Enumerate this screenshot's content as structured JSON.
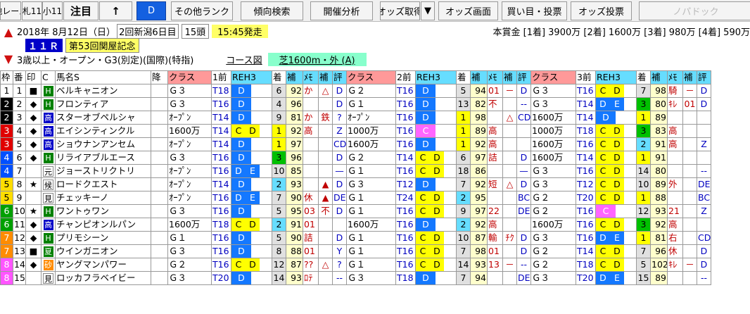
{
  "toolbar": {
    "buttons": [
      "他レース",
      "札11",
      "小11",
      "注目",
      "↑",
      "D",
      "その他ランク",
      "傾向検索",
      "開催分析",
      "オッズ取得",
      "▼",
      "オッズ画面",
      "買い目・投票",
      "オッズ投票",
      "ノパドック"
    ]
  },
  "race": {
    "date": "2018年",
    "date2": "8月12日（日）",
    "meeting": "2回新潟6日目",
    "runners": "15頭",
    "post_time": "15:45発走",
    "prize": "本賞金 [1着] 3900万 [2着] 1600万 [3着] 980万 [4着] 590万",
    "race_no": "１１Ｒ",
    "race_name": "第53回関屋記念",
    "conditions": "3歳以上・オープン・G3(別定)(国際)(特指)",
    "course_label": "コース図",
    "course": "芝1600m・外 (A)"
  },
  "columns": [
    "枠",
    "番",
    "印",
    "C",
    "馬名S",
    "降",
    "クラス",
    "1前",
    "REH3",
    "着",
    "補",
    "ﾒﾓ",
    "補",
    "評",
    "クラス",
    "2前",
    "REH3",
    "着",
    "補",
    "ﾒﾓ",
    "補",
    "評",
    "クラス",
    "3前",
    "REH3",
    "着",
    "補",
    "ﾒﾓ",
    "補",
    "評"
  ],
  "colors": {
    "accent": "#1460e0",
    "class_header": "#ff9999",
    "rating_header": "#66ddff",
    "race_mark_1": "#ffff00",
    "race_mark_2": "#66ddff"
  },
  "rows": [
    {
      "waku": "1",
      "wc": "#ffffff",
      "wt": "#000",
      "ban": "1",
      "mark": "■",
      "cbg": "#008000",
      "c": "H",
      "name": "ベルキャニオン",
      "r": [
        {
          "cls": "Ｇ３",
          "t": "T18",
          "rc": [
            "D"
          ],
          "rcb": [
            "#1478ff"
          ],
          "pos": "6",
          "h": "92",
          "memo": "か",
          "m2": "△",
          "ev": "D"
        },
        {
          "cls": "Ｇ２",
          "t": "T16",
          "rc": [
            "D"
          ],
          "rcb": [
            "#1478ff"
          ],
          "pos": "5",
          "h": "94",
          "memo": "01",
          "m2": "－",
          "ev": "D"
        },
        {
          "cls": "Ｇ３",
          "t": "T16",
          "rc": [
            "C",
            "D"
          ],
          "rcb": [
            "#ffff00",
            "#ffff00"
          ],
          "pos": "7",
          "h": "98",
          "memo": "騎",
          "m2": "－",
          "ev": "D"
        }
      ]
    },
    {
      "waku": "2",
      "wc": "#000000",
      "wt": "#fff",
      "ban": "2",
      "mark": "◆",
      "cbg": "#008000",
      "c": "H",
      "name": "フロンティア",
      "r": [
        {
          "cls": "Ｇ３",
          "t": "T16",
          "rc": [
            "D"
          ],
          "rcb": [
            "#1478ff"
          ],
          "pos": "4",
          "h": "96",
          "memo": "",
          "m2": "",
          "ev": "D"
        },
        {
          "cls": "Ｇ１",
          "t": "T16",
          "rc": [
            "D"
          ],
          "rcb": [
            "#1478ff"
          ],
          "pos": "13",
          "h": "82",
          "memo": "不",
          "m2": "",
          "ev": "--"
        },
        {
          "cls": "Ｇ３",
          "t": "T14",
          "rc": [
            "D",
            "E"
          ],
          "rcb": [
            "#1478ff",
            "#1478ff"
          ],
          "pos": "3",
          "h": "80",
          "memo": "ｷﾚ",
          "m2": "01",
          "ev": "D"
        }
      ]
    },
    {
      "waku": "2",
      "wc": "#000000",
      "wt": "#fff",
      "ban": "3",
      "mark": "◆",
      "cbg": "#0000c8",
      "c": "高",
      "name": "スターオブペルシャ",
      "r": [
        {
          "cls": "ｵｰﾌﾟﾝ",
          "t": "T14",
          "rc": [
            "D"
          ],
          "rcb": [
            "#1478ff"
          ],
          "pos": "9",
          "h": "81",
          "memo": "か",
          "m2": "鉄",
          "ev": "?"
        },
        {
          "cls": "ｵｰﾌﾟﾝ",
          "t": "T16",
          "rc": [
            "D"
          ],
          "rcb": [
            "#1478ff"
          ],
          "pos": "1",
          "h": "98",
          "memo": "",
          "m2": "△",
          "ev": "CD"
        },
        {
          "cls": "1600万",
          "t": "T14",
          "rc": [
            "D"
          ],
          "rcb": [
            "#1478ff"
          ],
          "pos": "1",
          "h": "89",
          "memo": "",
          "m2": "",
          "ev": ""
        }
      ]
    },
    {
      "waku": "3",
      "wc": "#e00000",
      "wt": "#fff",
      "ban": "4",
      "mark": "◆",
      "cbg": "#0000c8",
      "c": "高",
      "name": "エイシンティンクル",
      "r": [
        {
          "cls": "1600万",
          "t": "T14",
          "rc": [
            "C",
            "D"
          ],
          "rcb": [
            "#ffff00",
            "#ffff00"
          ],
          "pos": "1",
          "h": "92",
          "memo": "高",
          "m2": "",
          "ev": "Z"
        },
        {
          "cls": "1000万",
          "t": "T16",
          "rc": [
            "C"
          ],
          "rcb": [
            "#ff66ff"
          ],
          "pos": "1",
          "h": "89",
          "memo": "高",
          "m2": "",
          "ev": ""
        },
        {
          "cls": "1000万",
          "t": "T18",
          "rc": [
            "C",
            "D"
          ],
          "rcb": [
            "#ffff00",
            "#ffff00"
          ],
          "pos": "3",
          "h": "83",
          "memo": "高",
          "m2": "",
          "ev": ""
        }
      ]
    },
    {
      "waku": "3",
      "wc": "#e00000",
      "wt": "#fff",
      "ban": "5",
      "mark": "◆",
      "cbg": "#0000c8",
      "c": "高",
      "name": "ショウナンアンセム",
      "r": [
        {
          "cls": "ｵｰﾌﾟﾝ",
          "t": "T14",
          "rc": [
            "D"
          ],
          "rcb": [
            "#1478ff"
          ],
          "pos": "1",
          "h": "97",
          "memo": "",
          "m2": "",
          "ev": "CD"
        },
        {
          "cls": "1600万",
          "t": "T16",
          "rc": [
            "D"
          ],
          "rcb": [
            "#1478ff"
          ],
          "pos": "1",
          "h": "92",
          "memo": "高",
          "m2": "",
          "ev": ""
        },
        {
          "cls": "1600万",
          "t": "T16",
          "rc": [
            "C",
            "D"
          ],
          "rcb": [
            "#ffff00",
            "#ffff00"
          ],
          "pos": "2",
          "h": "91",
          "memo": "高",
          "m2": "",
          "ev": "Z"
        }
      ]
    },
    {
      "waku": "4",
      "wc": "#0050ff",
      "wt": "#fff",
      "ban": "6",
      "mark": "◆",
      "cbg": "#008000",
      "c": "H",
      "name": "リライアブルエース",
      "r": [
        {
          "cls": "Ｇ３",
          "t": "T16",
          "rc": [
            "D"
          ],
          "rcb": [
            "#1478ff"
          ],
          "pos": "3",
          "h": "96",
          "memo": "",
          "m2": "",
          "ev": "D"
        },
        {
          "cls": "Ｇ２",
          "t": "T14",
          "rc": [
            "C",
            "D"
          ],
          "rcb": [
            "#ffff00",
            "#ffff00"
          ],
          "pos": "6",
          "h": "97",
          "memo": "詰",
          "m2": "",
          "ev": "D"
        },
        {
          "cls": "1600万",
          "t": "T14",
          "rc": [
            "C",
            "D"
          ],
          "rcb": [
            "#ffff00",
            "#ffff00"
          ],
          "pos": "1",
          "h": "91",
          "memo": "",
          "m2": "",
          "ev": ""
        }
      ]
    },
    {
      "waku": "4",
      "wc": "#0050ff",
      "wt": "#fff",
      "ban": "7",
      "mark": "",
      "cbg": "#ffffff",
      "c": "元",
      "name": "ジョーストリクトリ",
      "r": [
        {
          "cls": "ｵｰﾌﾟﾝ",
          "t": "T16",
          "rc": [
            "D",
            "E"
          ],
          "rcb": [
            "#1478ff",
            "#1478ff"
          ],
          "pos": "10",
          "h": "85",
          "memo": "",
          "m2": "",
          "ev": "—"
        },
        {
          "cls": "Ｇ１",
          "t": "T16",
          "rc": [
            "C",
            "D"
          ],
          "rcb": [
            "#ffff00",
            "#ffff00"
          ],
          "pos": "18",
          "h": "86",
          "memo": "",
          "m2": "",
          "ev": "—"
        },
        {
          "cls": "Ｇ３",
          "t": "T16",
          "rc": [
            "C",
            "D"
          ],
          "rcb": [
            "#ffff00",
            "#ffff00"
          ],
          "pos": "14",
          "h": "80",
          "memo": "",
          "m2": "",
          "ev": "--"
        }
      ]
    },
    {
      "waku": "5",
      "wc": "#ffdd00",
      "wt": "#000",
      "ban": "8",
      "mark": "★",
      "cbg": "#ffffff",
      "c": "候",
      "name": "ロードクエスト",
      "r": [
        {
          "cls": "ｵｰﾌﾟﾝ",
          "t": "T14",
          "rc": [
            "D"
          ],
          "rcb": [
            "#1478ff"
          ],
          "pos": "2",
          "h": "93",
          "memo": "",
          "m2": "▲",
          "ev": "D"
        },
        {
          "cls": "Ｇ３",
          "t": "T12",
          "rc": [
            "D"
          ],
          "rcb": [
            "#1478ff"
          ],
          "pos": "7",
          "h": "92",
          "memo": "短",
          "m2": "△",
          "ev": "D"
        },
        {
          "cls": "Ｇ３",
          "t": "T12",
          "rc": [
            "C",
            "D"
          ],
          "rcb": [
            "#ffff00",
            "#ffff00"
          ],
          "pos": "10",
          "h": "89",
          "memo": "外",
          "m2": "",
          "ev": "DE"
        }
      ]
    },
    {
      "waku": "5",
      "wc": "#ffdd00",
      "wt": "#000",
      "ban": "9",
      "mark": "",
      "cbg": "#ffffff",
      "c": "見",
      "name": "チェッキーノ",
      "r": [
        {
          "cls": "ｵｰﾌﾟﾝ",
          "t": "T16",
          "rc": [
            "D",
            "E"
          ],
          "rcb": [
            "#1478ff",
            "#1478ff"
          ],
          "pos": "7",
          "h": "90",
          "memo": "休",
          "m2": "▲",
          "ev": "DE"
        },
        {
          "cls": "Ｇ１",
          "t": "T24",
          "rc": [
            "C",
            "D"
          ],
          "rcb": [
            "#ffff00",
            "#ffff00"
          ],
          "pos": "2",
          "h": "95",
          "memo": "",
          "m2": "",
          "ev": "BC"
        },
        {
          "cls": "Ｇ２",
          "t": "T20",
          "rc": [
            "C",
            "D"
          ],
          "rcb": [
            "#ffff00",
            "#ffff00"
          ],
          "pos": "1",
          "h": "88",
          "memo": "",
          "m2": "",
          "ev": "BC"
        }
      ]
    },
    {
      "waku": "6",
      "wc": "#00a000",
      "wt": "#fff",
      "ban": "10",
      "mark": "★",
      "cbg": "#008000",
      "c": "H",
      "name": "ワントゥワン",
      "r": [
        {
          "cls": "Ｇ３",
          "t": "T16",
          "rc": [
            "D"
          ],
          "rcb": [
            "#1478ff"
          ],
          "pos": "5",
          "h": "95",
          "memo": "03",
          "m2": "不",
          "ev": "D"
        },
        {
          "cls": "Ｇ１",
          "t": "T16",
          "rc": [
            "C",
            "D"
          ],
          "rcb": [
            "#ffff00",
            "#ffff00"
          ],
          "pos": "9",
          "h": "97",
          "memo": "22",
          "m2": "",
          "ev": "DE"
        },
        {
          "cls": "Ｇ２",
          "t": "T16",
          "rc": [
            "C"
          ],
          "rcb": [
            "#ff66ff"
          ],
          "pos": "12",
          "h": "93",
          "memo": "21",
          "m2": "",
          "ev": "Z"
        }
      ]
    },
    {
      "waku": "6",
      "wc": "#00a000",
      "wt": "#fff",
      "ban": "11",
      "mark": "◆",
      "cbg": "#0000c8",
      "c": "高",
      "name": "チャンピオンルパン",
      "r": [
        {
          "cls": "1600万",
          "t": "T18",
          "rc": [
            "C",
            "D"
          ],
          "rcb": [
            "#ffff00",
            "#ffff00"
          ],
          "pos": "2",
          "h": "91",
          "memo": "01",
          "m2": "",
          "ev": ""
        },
        {
          "cls": "1600万",
          "t": "T16",
          "rc": [
            "D"
          ],
          "rcb": [
            "#1478ff"
          ],
          "pos": "2",
          "h": "92",
          "memo": "高",
          "m2": "",
          "ev": ""
        },
        {
          "cls": "1600万",
          "t": "T16",
          "rc": [
            "C",
            "D"
          ],
          "rcb": [
            "#ffff00",
            "#ffff00"
          ],
          "pos": "3",
          "h": "92",
          "memo": "高",
          "m2": "",
          "ev": ""
        }
      ]
    },
    {
      "waku": "7",
      "wc": "#ff8c00",
      "wt": "#fff",
      "ban": "12",
      "mark": "◆",
      "cbg": "#008000",
      "c": "H",
      "name": "プリモシーン",
      "r": [
        {
          "cls": "Ｇ１",
          "t": "T16",
          "rc": [
            "D"
          ],
          "rcb": [
            "#1478ff"
          ],
          "pos": "5",
          "h": "90",
          "memo": "詰",
          "m2": "",
          "ev": "D"
        },
        {
          "cls": "Ｇ１",
          "t": "T16",
          "rc": [
            "C",
            "D"
          ],
          "rcb": [
            "#ffff00",
            "#ffff00"
          ],
          "pos": "10",
          "h": "87",
          "memo": "輸",
          "m2": "ﾁｸ",
          "ev": "D"
        },
        {
          "cls": "Ｇ３",
          "t": "T16",
          "rc": [
            "D",
            "E"
          ],
          "rcb": [
            "#1478ff",
            "#1478ff"
          ],
          "pos": "1",
          "h": "81",
          "memo": "右",
          "m2": "",
          "ev": "CD"
        }
      ]
    },
    {
      "waku": "7",
      "wc": "#ff8c00",
      "wt": "#fff",
      "ban": "13",
      "mark": "■",
      "cbg": "#008000",
      "c": "夏",
      "name": "ウインガニオン",
      "r": [
        {
          "cls": "Ｇ３",
          "t": "T16",
          "rc": [
            "D"
          ],
          "rcb": [
            "#1478ff"
          ],
          "pos": "8",
          "h": "88",
          "memo": "01",
          "m2": "",
          "ev": "Y"
        },
        {
          "cls": "Ｇ１",
          "t": "T16",
          "rc": [
            "C",
            "D"
          ],
          "rcb": [
            "#ffff00",
            "#ffff00"
          ],
          "pos": "7",
          "h": "98",
          "memo": "01",
          "m2": "",
          "ev": "D"
        },
        {
          "cls": "Ｇ２",
          "t": "T14",
          "rc": [
            "C",
            "D"
          ],
          "rcb": [
            "#ffff00",
            "#ffff00"
          ],
          "pos": "7",
          "h": "96",
          "memo": "休",
          "m2": "",
          "ev": "D"
        }
      ]
    },
    {
      "waku": "8",
      "wc": "#ff55ff",
      "wt": "#fff",
      "ban": "14",
      "mark": "◆",
      "cbg": "#ff8c00",
      "c": "砂",
      "name": "ヤングマンパワー",
      "r": [
        {
          "cls": "Ｇ２",
          "t": "T16",
          "rc": [
            "C",
            "D"
          ],
          "rcb": [
            "#ffff00",
            "#ffff00"
          ],
          "pos": "12",
          "h": "87",
          "memo": "??",
          "m2": "△",
          "ev": "?"
        },
        {
          "cls": "Ｇ１",
          "t": "T16",
          "rc": [
            "C",
            "D"
          ],
          "rcb": [
            "#ffff00",
            "#ffff00"
          ],
          "pos": "14",
          "h": "93",
          "memo": "13",
          "m2": "－",
          "ev": "--"
        },
        {
          "cls": "Ｇ２",
          "t": "T18",
          "rc": [
            "C",
            "D"
          ],
          "rcb": [
            "#ffff00",
            "#ffff00"
          ],
          "pos": "5",
          "h": "102",
          "memo": "ｷﾚ",
          "m2": "－",
          "ev": "D"
        }
      ]
    },
    {
      "waku": "8",
      "wc": "#ff55ff",
      "wt": "#fff",
      "ban": "15",
      "mark": "",
      "cbg": "#ffffff",
      "c": "見",
      "name": "ロッカフラベイビー",
      "r": [
        {
          "cls": "Ｇ３",
          "t": "T20",
          "rc": [
            "D"
          ],
          "rcb": [
            "#1478ff"
          ],
          "pos": "14",
          "h": "93",
          "memo": "ﾛﾃ",
          "m2": "",
          "ev": "--"
        },
        {
          "cls": "Ｇ３",
          "t": "T18",
          "rc": [
            "D"
          ],
          "rcb": [
            "#1478ff"
          ],
          "pos": "7",
          "h": "94",
          "memo": "",
          "m2": "",
          "ev": "DE"
        },
        {
          "cls": "Ｇ３",
          "t": "T20",
          "rc": [
            "D",
            "E"
          ],
          "rcb": [
            "#1478ff",
            "#1478ff"
          ],
          "pos": "15",
          "h": "89",
          "memo": "",
          "m2": "",
          "ev": "--"
        }
      ]
    }
  ]
}
